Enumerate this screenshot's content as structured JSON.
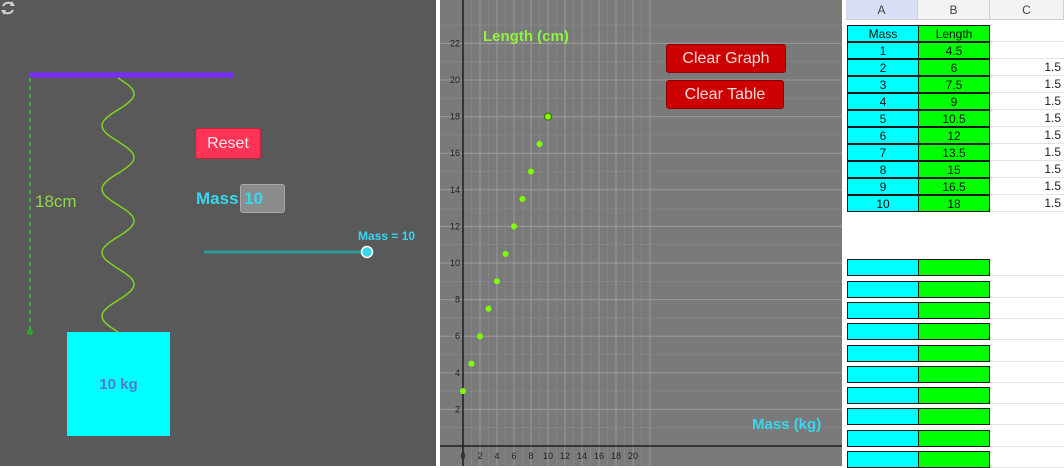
{
  "simulation": {
    "reset_label": "Reset",
    "mass_label": "Mass",
    "mass_value": "10",
    "slider_caption": "Mass = 10",
    "slider_fraction": 1.0,
    "length_label": "18cm",
    "mass_box_label": "10 kg",
    "colors": {
      "bar": "#7a2cff",
      "spring": "#7ed321",
      "mass_box": "#00ffff",
      "reset": "#ff3355"
    }
  },
  "graph": {
    "clear_graph_label": "Clear Graph",
    "clear_table_label": "Clear Table"
  },
  "chart_data": {
    "type": "scatter",
    "ylabel": "Length (cm)",
    "xlabel": "Mass (kg)",
    "xlim": [
      0,
      22
    ],
    "ylim": [
      0,
      23
    ],
    "x_ticks": [
      0,
      2,
      4,
      6,
      8,
      10,
      12,
      14,
      16,
      18,
      20
    ],
    "y_ticks": [
      2,
      4,
      6,
      8,
      10,
      12,
      14,
      16,
      18,
      20,
      22
    ],
    "grid": true,
    "x": [
      0,
      1,
      2,
      3,
      4,
      5,
      6,
      7,
      8,
      9,
      10
    ],
    "y": [
      3,
      4.5,
      6,
      7.5,
      9,
      10.5,
      12,
      13.5,
      15,
      16.5,
      18
    ],
    "point_color": "#7fff00"
  },
  "sheet": {
    "columns": [
      "A",
      "B",
      "C"
    ],
    "header_row": [
      "Mass",
      "Length"
    ],
    "rows": [
      {
        "a": "1",
        "b": "4.5",
        "c": ""
      },
      {
        "a": "2",
        "b": "6",
        "c": "1.5"
      },
      {
        "a": "3",
        "b": "7.5",
        "c": "1.5"
      },
      {
        "a": "4",
        "b": "9",
        "c": "1.5"
      },
      {
        "a": "5",
        "b": "10.5",
        "c": "1.5"
      },
      {
        "a": "6",
        "b": "12",
        "c": "1.5"
      },
      {
        "a": "7",
        "b": "13.5",
        "c": "1.5"
      },
      {
        "a": "8",
        "b": "15",
        "c": "1.5"
      },
      {
        "a": "9",
        "b": "16.5",
        "c": "1.5"
      },
      {
        "a": "10",
        "b": "18",
        "c": "1.5"
      }
    ],
    "empty_rows": 10
  }
}
